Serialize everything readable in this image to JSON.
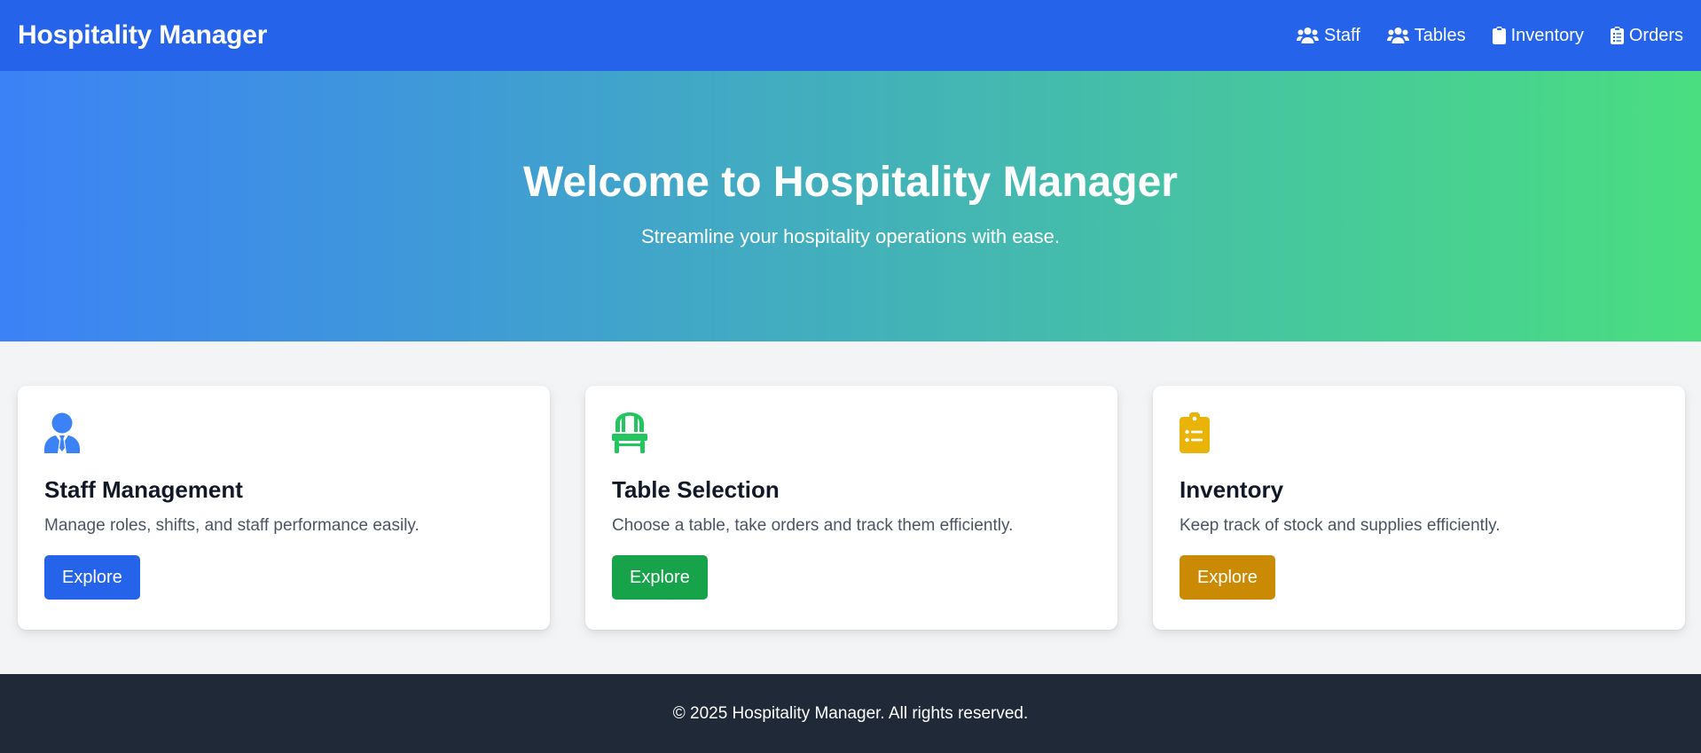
{
  "header": {
    "brand": "Hospitality Manager",
    "nav": [
      {
        "label": "Staff",
        "icon": "users-icon"
      },
      {
        "label": "Tables",
        "icon": "users-icon"
      },
      {
        "label": "Inventory",
        "icon": "clipboard-icon"
      },
      {
        "label": "Orders",
        "icon": "clipboard-list-icon"
      }
    ]
  },
  "hero": {
    "title": "Welcome to Hospitality Manager",
    "subtitle": "Streamline your hospitality operations with ease."
  },
  "cards": [
    {
      "icon": "user-tie-icon",
      "title": "Staff Management",
      "description": "Manage roles, shifts, and staff performance easily.",
      "button_label": "Explore",
      "accent": "#2563eb"
    },
    {
      "icon": "chair-icon",
      "title": "Table Selection",
      "description": "Choose a table, take orders and track them efficiently.",
      "button_label": "Explore",
      "accent": "#16a34a"
    },
    {
      "icon": "clipboard-list-icon",
      "title": "Inventory",
      "description": "Keep track of stock and supplies efficiently.",
      "button_label": "Explore",
      "accent": "#ca8a04"
    }
  ],
  "footer": {
    "text": "© 2025 Hospitality Manager. All rights reserved."
  },
  "colors": {
    "nav_bg": "#2563eb",
    "hero_gradient_start": "#3b82f6",
    "hero_gradient_end": "#4ade80",
    "page_bg": "#f3f4f6",
    "footer_bg": "#1f2937"
  }
}
